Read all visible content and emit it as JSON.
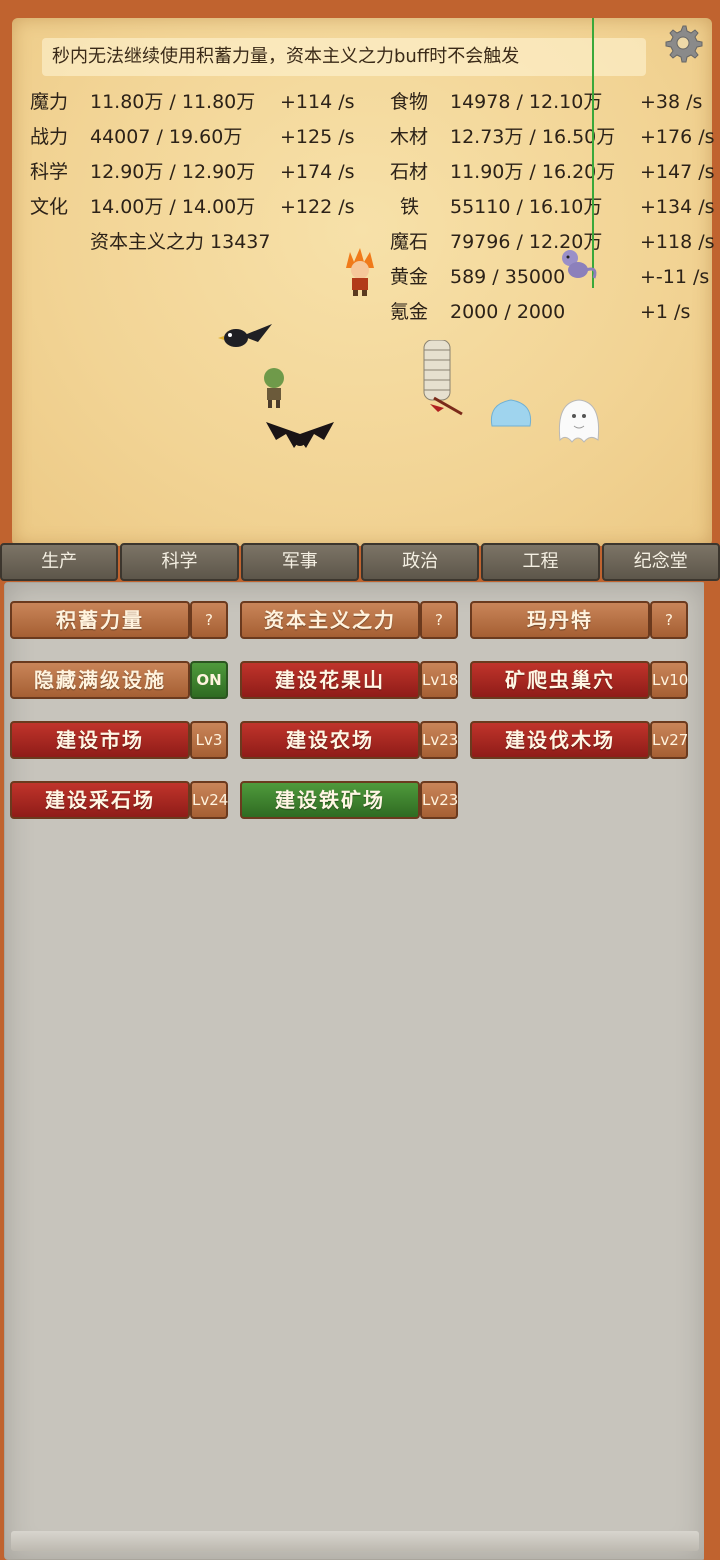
{
  "notice": "秒内无法继续使用积蓄力量，资本主义之力buff时不会触发",
  "stats_left": [
    {
      "name": "魔力",
      "amount": "11.80万 / 11.80万",
      "rate": "+114 /s"
    },
    {
      "name": "战力",
      "amount": "44007 / 19.60万",
      "rate": "+125 /s"
    },
    {
      "name": "科学",
      "amount": "12.90万 / 12.90万",
      "rate": "+174 /s"
    },
    {
      "name": "文化",
      "amount": "14.00万 / 14.00万",
      "rate": "+122 /s"
    }
  ],
  "capitalism_power": "资本主义之力 13437",
  "stats_right": [
    {
      "name": "食物",
      "amount": "14978 / 12.10万",
      "rate": "+38 /s"
    },
    {
      "name": "木材",
      "amount": "12.73万 / 16.50万",
      "rate": "+176 /s"
    },
    {
      "name": "石材",
      "amount": "11.90万 / 16.20万",
      "rate": "+147 /s"
    },
    {
      "name": "铁",
      "amount": "55110 / 16.10万",
      "rate": "+134 /s"
    },
    {
      "name": "魔石",
      "amount": "79796 / 12.20万",
      "rate": "+118 /s"
    },
    {
      "name": "黄金",
      "amount": "589 / 35000",
      "rate": "+-11 /s"
    },
    {
      "name": "氪金",
      "amount": "2000 / 2000",
      "rate": "+1 /s"
    }
  ],
  "tabs": [
    "生产",
    "科学",
    "军事",
    "政治",
    "工程",
    "纪念堂"
  ],
  "buttons": {
    "accumulate": "积蓄力量",
    "capitalism": "资本主义之力",
    "mardant": "玛丹特",
    "help": "?",
    "hide_max": "隐藏满级设施",
    "hide_max_state": "ON",
    "huaguoshan": "建设花果山",
    "huaguoshan_lv": "Lv18",
    "bug_nest": "矿爬虫巢穴",
    "bug_nest_lv": "Lv10",
    "market": "建设市场",
    "market_lv": "Lv3",
    "farm": "建设农场",
    "farm_lv": "Lv23",
    "lumber": "建设伐木场",
    "lumber_lv": "Lv27",
    "quarry": "建设采石场",
    "quarry_lv": "Lv24",
    "iron_mine": "建设铁矿场",
    "iron_mine_lv": "Lv23"
  },
  "colors": {
    "frame": "#c0632f",
    "parchment": "#f2d495",
    "red_btn": "#b02a22",
    "green_btn": "#3f8530",
    "brown_btn": "#b66f44"
  }
}
